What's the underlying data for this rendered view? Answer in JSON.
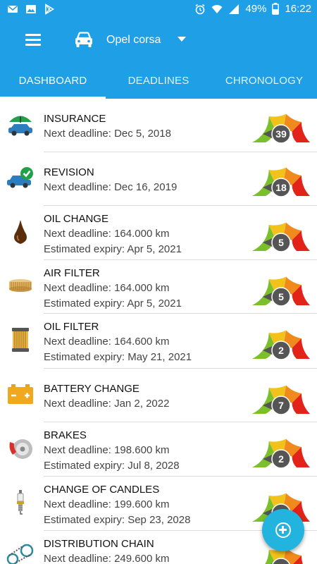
{
  "status_bar": {
    "battery_percent": "49%",
    "time": "16:22",
    "icons": [
      "mail-icon",
      "image-icon",
      "play-store-icon",
      "alarm-icon",
      "wifi-icon",
      "signal-icon",
      "battery-icon"
    ]
  },
  "app_bar": {
    "car_name": "Opel corsa",
    "icons": [
      "menu-icon",
      "car-icon",
      "chevron-down-icon"
    ]
  },
  "tabs": [
    {
      "label": "DASHBOARD",
      "active": true
    },
    {
      "label": "DEADLINES",
      "active": false
    },
    {
      "label": "CHRONOLOGY",
      "active": false
    }
  ],
  "items": [
    {
      "title": "INSURANCE",
      "lines": [
        "Next deadline: Dec 5, 2018"
      ],
      "gauge": "39",
      "icon": "umbrella-car-icon"
    },
    {
      "title": "REVISION",
      "lines": [
        "Next deadline: Dec 16, 2019"
      ],
      "gauge": "18",
      "icon": "car-check-icon"
    },
    {
      "title": "OIL CHANGE",
      "lines": [
        "Next deadline: 164.000 km",
        "Estimated expiry: Apr 5, 2021"
      ],
      "gauge": "5",
      "icon": "oil-drop-icon"
    },
    {
      "title": "AIR FILTER",
      "lines": [
        "Next deadline: 164.000 km",
        "Estimated expiry: Apr 5, 2021"
      ],
      "gauge": "5",
      "icon": "air-filter-icon"
    },
    {
      "title": "OIL FILTER",
      "lines": [
        "Next deadline: 164.600 km",
        "Estimated expiry: May 21, 2021"
      ],
      "gauge": "2",
      "icon": "oil-filter-icon"
    },
    {
      "title": "BATTERY CHANGE",
      "lines": [
        "Next deadline: Jan 2, 2022"
      ],
      "gauge": "7",
      "icon": "battery-car-icon"
    },
    {
      "title": "BRAKES",
      "lines": [
        "Next deadline: 198.600 km",
        "Estimated expiry: Jul 8, 2028"
      ],
      "gauge": "2",
      "icon": "brake-disc-icon"
    },
    {
      "title": "CHANGE OF CANDLES",
      "lines": [
        "Next deadline: 199.600 km",
        "Estimated expiry: Sep 23, 2028"
      ],
      "gauge": "",
      "icon": "spark-plug-icon"
    },
    {
      "title": "DISTRIBUTION CHAIN",
      "lines": [
        "Next deadline: 249.600 km"
      ],
      "gauge": "",
      "icon": "chain-icon"
    }
  ],
  "colors": {
    "primary": "#1e9fe6",
    "fab": "#22b3df",
    "gauge_green": "#7bbf2a",
    "gauge_yellow": "#f2c21b",
    "gauge_orange": "#f08a1c",
    "gauge_red": "#e2231a",
    "needle": "#555555"
  }
}
